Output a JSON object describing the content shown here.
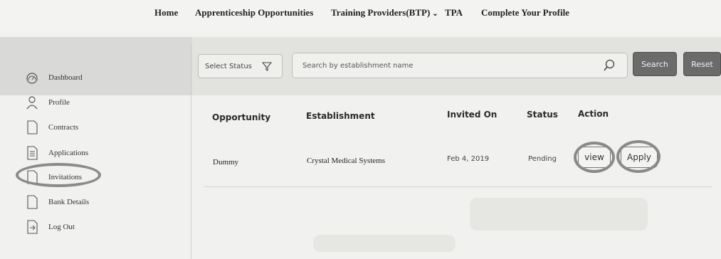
{
  "nav": {
    "home": "Home",
    "apprenticeship": "Apprenticeship Opportunities",
    "training_providers": "Training Providers(BTP)",
    "tpa": "TPA",
    "complete_profile": "Complete Your Profile"
  },
  "sidebar": {
    "items": [
      {
        "label": "Dashboard",
        "icon": "dashboard-gauge-icon"
      },
      {
        "label": "Profile",
        "icon": "user-icon"
      },
      {
        "label": "Contracts",
        "icon": "document-icon"
      },
      {
        "label": "Applications",
        "icon": "document-lines-icon"
      },
      {
        "label": "Invitations",
        "icon": "document-icon"
      },
      {
        "label": "Bank Details",
        "icon": "document-icon"
      },
      {
        "label": "Log Out",
        "icon": "logout-icon"
      }
    ]
  },
  "filters": {
    "status_label": "Select Status",
    "search_placeholder": "Search by establishment name",
    "search_button": "Search",
    "reset_button": "Reset"
  },
  "table": {
    "headers": [
      "Opportunity",
      "Establishment",
      "Invited On",
      "Status",
      "Action"
    ],
    "rows": [
      {
        "opportunity": "Dummy",
        "establishment": "Crystal Medical Systems",
        "invited_on": "Feb 4, 2019",
        "status": "Pending",
        "view": "view",
        "apply": "Apply"
      }
    ]
  },
  "colors": {
    "band": "#d9d9d7",
    "button": "#6b6b6b",
    "highlight_ring": "#8a8a8a"
  }
}
